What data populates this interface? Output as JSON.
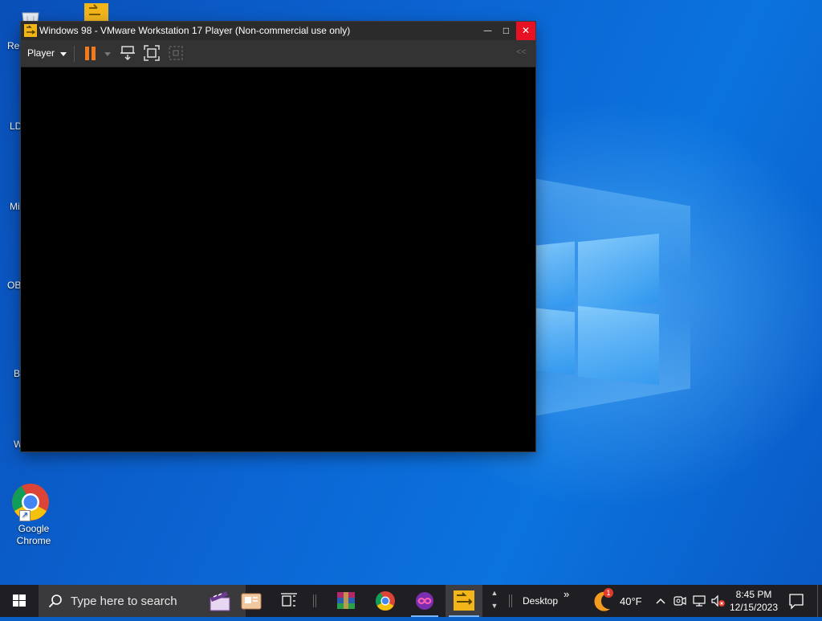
{
  "desktop": {
    "icons": [
      {
        "label": "Rec"
      },
      {
        "label": "LD"
      },
      {
        "label": "Mi"
      },
      {
        "label": "OB"
      },
      {
        "label": "B"
      },
      {
        "label": "WinRAR"
      },
      {
        "label": "Google Chrome"
      }
    ]
  },
  "vmware": {
    "title": "Windows 98 - VMware Workstation 17 Player (Non-commercial use only)",
    "toolbar": {
      "player_menu": "Player",
      "collapse": "<<"
    },
    "window_buttons": {
      "minimize": "—",
      "maximize": "□",
      "close": "✕"
    }
  },
  "taskbar": {
    "search_placeholder": "Type here to search",
    "desktop_toolbar": "Desktop",
    "chevron": "»",
    "weather_badge": "1",
    "temperature": "40°F",
    "time": "8:45 PM",
    "date": "12/15/2023"
  },
  "colors": {
    "close_red": "#e81123",
    "pause_orange": "#f07a1c",
    "taskbar_bg": "#1f1f23"
  }
}
